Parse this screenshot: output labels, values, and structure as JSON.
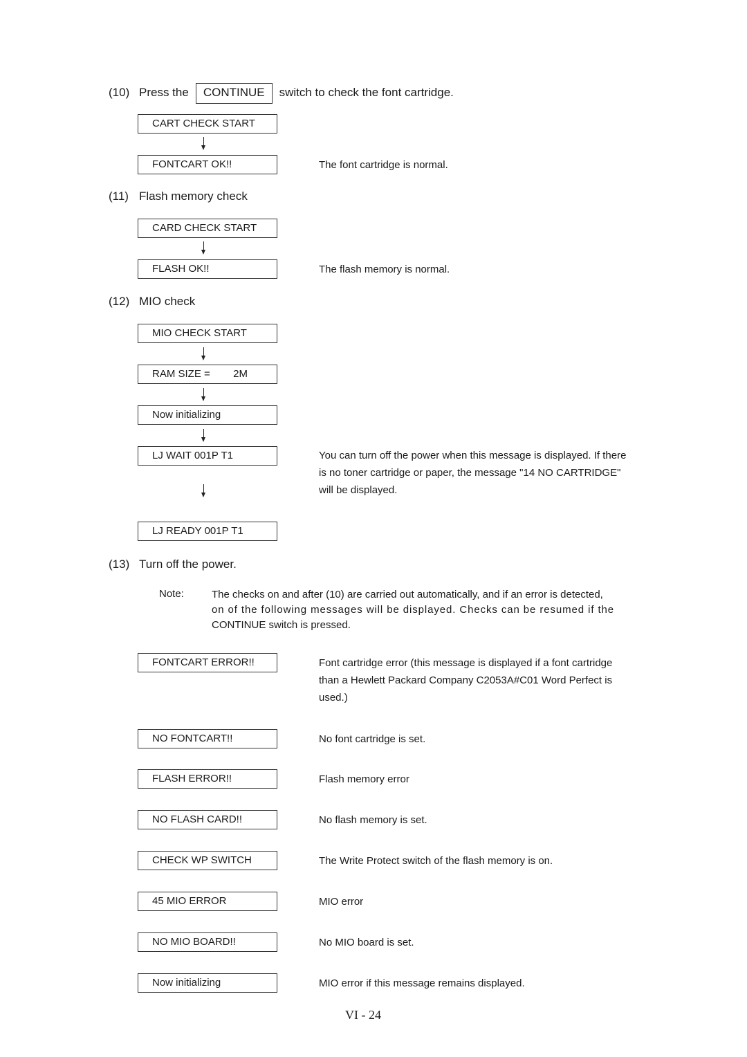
{
  "step10": {
    "number": "(10)",
    "prefix": "Press the",
    "key_label": "CONTINUE",
    "suffix": "switch to check the font cartridge.",
    "flow": [
      "CART CHECK START",
      "FONTCART OK!!"
    ],
    "result_description": "The font cartridge is normal."
  },
  "step11": {
    "number": "(11)",
    "title": "Flash memory check",
    "flow": [
      "CARD CHECK START",
      "FLASH OK!!"
    ],
    "result_description": "The flash memory is normal."
  },
  "step12": {
    "number": "(12)",
    "title": "MIO check",
    "flow": [
      "MIO CHECK START",
      "RAM SIZE =        2M",
      "Now initializing",
      "LJ WAIT 001P T1",
      "LJ READY 001P T1"
    ],
    "wait_description_lines": [
      "You can turn off the power when this message is displayed. If there",
      "is no toner cartridge or paper, the message \"14 NO CARTRIDGE\"",
      "will be displayed."
    ]
  },
  "step13": {
    "number": "(13)",
    "title": "Turn off the power."
  },
  "note": {
    "label": "Note:",
    "lines": [
      "The checks on and after (10) are carried out automatically, and if an error is detected,",
      "on of the following messages will be displayed. Checks can be resumed if the",
      "CONTINUE switch is pressed."
    ]
  },
  "errors": [
    {
      "message": "FONTCART ERROR!!",
      "description_lines": [
        "Font cartridge error (this message is displayed if a font cartridge",
        "than a Hewlett Packard Company C2053A#C01 Word Perfect is",
        "used.)"
      ]
    },
    {
      "message": "NO FONTCART!!",
      "description_lines": [
        "No font cartridge is set."
      ]
    },
    {
      "message": "FLASH ERROR!!",
      "description_lines": [
        "Flash memory error"
      ]
    },
    {
      "message": "NO FLASH CARD!!",
      "description_lines": [
        "No flash memory is set."
      ]
    },
    {
      "message": "CHECK WP SWITCH",
      "description_lines": [
        "The Write Protect switch of the flash memory is on."
      ]
    },
    {
      "message": "45 MIO ERROR",
      "description_lines": [
        "MIO error"
      ]
    },
    {
      "message": "NO MIO BOARD!!",
      "description_lines": [
        "No MIO board is set."
      ]
    },
    {
      "message": "Now initializing",
      "description_lines": [
        "MIO error if this message remains displayed."
      ]
    }
  ],
  "footer": {
    "page_number": "VI - 24"
  }
}
